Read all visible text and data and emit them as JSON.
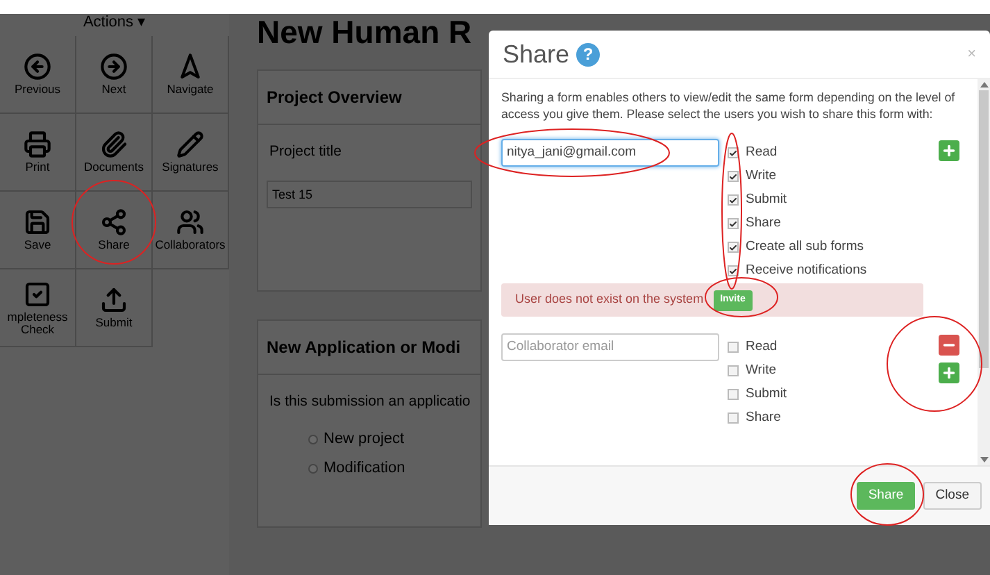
{
  "sidebar": {
    "header": "Actions",
    "caret": "▾",
    "actions": [
      {
        "kind": "previous",
        "label": "Previous"
      },
      {
        "kind": "next",
        "label": "Next"
      },
      {
        "kind": "navigate",
        "label": "Navigate"
      },
      {
        "kind": "print",
        "label": "Print"
      },
      {
        "kind": "documents",
        "label": "Documents"
      },
      {
        "kind": "signatures",
        "label": "Signatures"
      },
      {
        "kind": "save",
        "label": "Save"
      },
      {
        "kind": "share",
        "label": "Share"
      },
      {
        "kind": "collaborators",
        "label": "Collaborators"
      },
      {
        "kind": "check",
        "label": "mpleteness Check"
      },
      {
        "kind": "submit",
        "label": "Submit"
      }
    ]
  },
  "page": {
    "title": "New Human R",
    "sections": [
      {
        "title": "Project Overview",
        "question": "Project title",
        "value": "Test 15"
      },
      {
        "title": "New Application or Modi",
        "question": "Is this submission an applicatio",
        "options": [
          {
            "label": "New project",
            "selected": false
          },
          {
            "label": "Modification",
            "selected": false
          }
        ]
      }
    ]
  },
  "dialog": {
    "title": "Share",
    "help": "?",
    "close": "×",
    "intro": "Sharing a form enables others to view/edit the same form depending on the level of access you give them. Please select the users you wish to share this form with:",
    "collaborators": [
      {
        "email": "nitya_jani@gmail.com",
        "focused": true,
        "permissions": [
          {
            "label": "Read",
            "checked": true
          },
          {
            "label": "Write",
            "checked": true
          },
          {
            "label": "Submit",
            "checked": true
          },
          {
            "label": "Share",
            "checked": true
          },
          {
            "label": "Create all sub forms",
            "checked": true
          },
          {
            "label": "Receive notifications",
            "checked": true
          }
        ],
        "removable": false,
        "error": "User does not exist on the system",
        "error_action": "Invite"
      },
      {
        "placeholder": "Collaborator email",
        "focused": false,
        "permissions": [
          {
            "label": "Read",
            "checked": false
          },
          {
            "label": "Write",
            "checked": false
          },
          {
            "label": "Submit",
            "checked": false
          },
          {
            "label": "Share",
            "checked": false
          }
        ],
        "removable": true
      }
    ],
    "buttons": [
      {
        "kind": "primary",
        "label": "Share"
      },
      {
        "kind": "default",
        "label": "Close"
      }
    ]
  }
}
